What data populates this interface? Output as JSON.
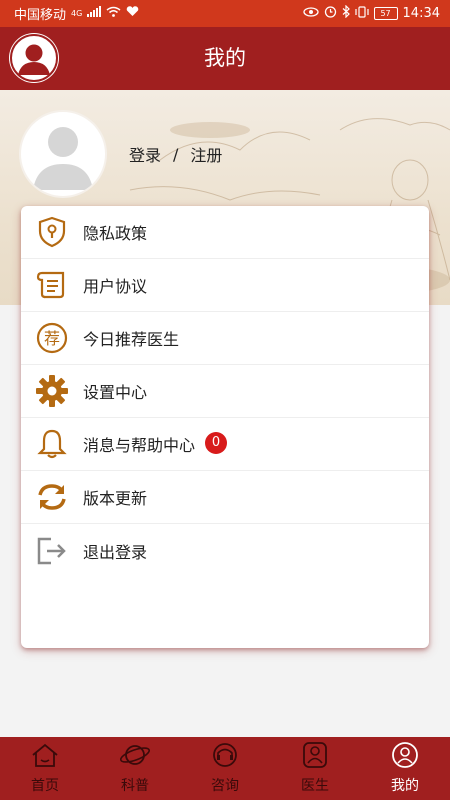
{
  "status_bar": {
    "carrier": "中国移动",
    "network": "4G",
    "battery": "57",
    "time": "14:34"
  },
  "header": {
    "title": "我的"
  },
  "profile": {
    "login_label": "登录",
    "separator": "/",
    "register_label": "注册"
  },
  "menu": {
    "items": [
      {
        "label": "隐私政策",
        "icon": "shield-lock-icon"
      },
      {
        "label": "用户协议",
        "icon": "scroll-icon"
      },
      {
        "label": "今日推荐医生",
        "icon": "recommend-icon",
        "icon_text": "荐"
      },
      {
        "label": "设置中心",
        "icon": "gear-icon"
      },
      {
        "label": "消息与帮助中心",
        "icon": "bell-icon",
        "badge": "0"
      },
      {
        "label": "版本更新",
        "icon": "refresh-icon"
      },
      {
        "label": "退出登录",
        "icon": "logout-icon"
      }
    ]
  },
  "bottom_nav": {
    "items": [
      {
        "label": "首页",
        "icon": "home-icon"
      },
      {
        "label": "科普",
        "icon": "planet-icon"
      },
      {
        "label": "咨询",
        "icon": "headset-icon"
      },
      {
        "label": "医生",
        "icon": "doctor-icon"
      },
      {
        "label": "我的",
        "icon": "user-icon",
        "active": true
      }
    ]
  },
  "colors": {
    "status_bar": "#d0381c",
    "header": "#a01f1f",
    "icon_accent": "#b46a12",
    "badge": "#d81b1b"
  }
}
